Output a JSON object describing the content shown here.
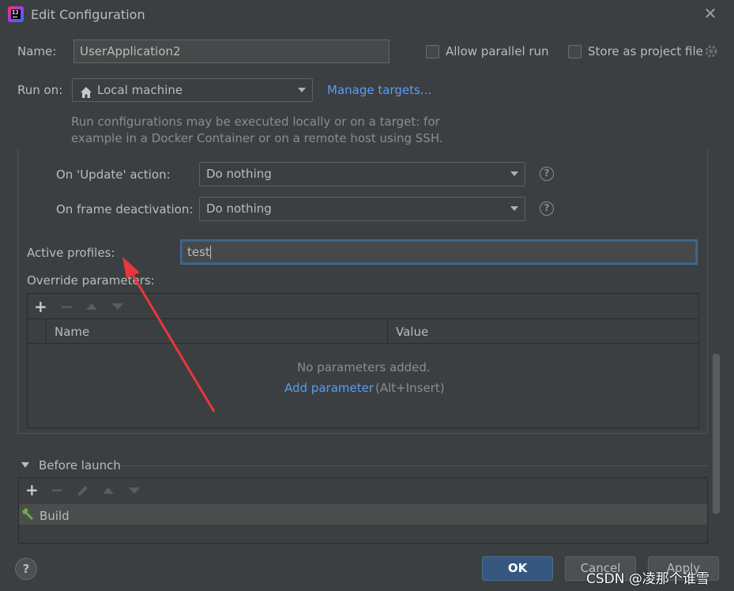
{
  "window": {
    "title": "Edit Configuration"
  },
  "name_row": {
    "label": "Name:",
    "value": "UserApplication2",
    "allow_parallel": "Allow parallel run",
    "store_project": "Store as project file"
  },
  "run_on": {
    "label": "Run on:",
    "value": "Local machine",
    "manage": "Manage targets...",
    "hint1": "Run configurations may be executed locally or on a target: for",
    "hint2": "example in a Docker Container or on a remote host using SSH."
  },
  "update_action": {
    "label": "On 'Update' action:",
    "value": "Do nothing"
  },
  "frame_deactivation": {
    "label": "On frame deactivation:",
    "value": "Do nothing"
  },
  "active_profiles": {
    "label": "Active profiles:",
    "value": "test"
  },
  "override": {
    "label": "Override parameters:",
    "columns": [
      "Name",
      "Value"
    ],
    "empty_text": "No parameters added.",
    "add_link": "Add parameter",
    "add_shortcut": "(Alt+Insert)"
  },
  "before_launch": {
    "label": "Before launch",
    "items": [
      "Build"
    ]
  },
  "footer": {
    "ok": "OK",
    "cancel": "Cancel",
    "apply": "Apply",
    "help": "?"
  },
  "watermark": "CSDN @凌那个谁雪",
  "colors": {
    "accent": "#589df6",
    "annotation_arrow": "#e8373d",
    "primary_button": "#365880"
  }
}
